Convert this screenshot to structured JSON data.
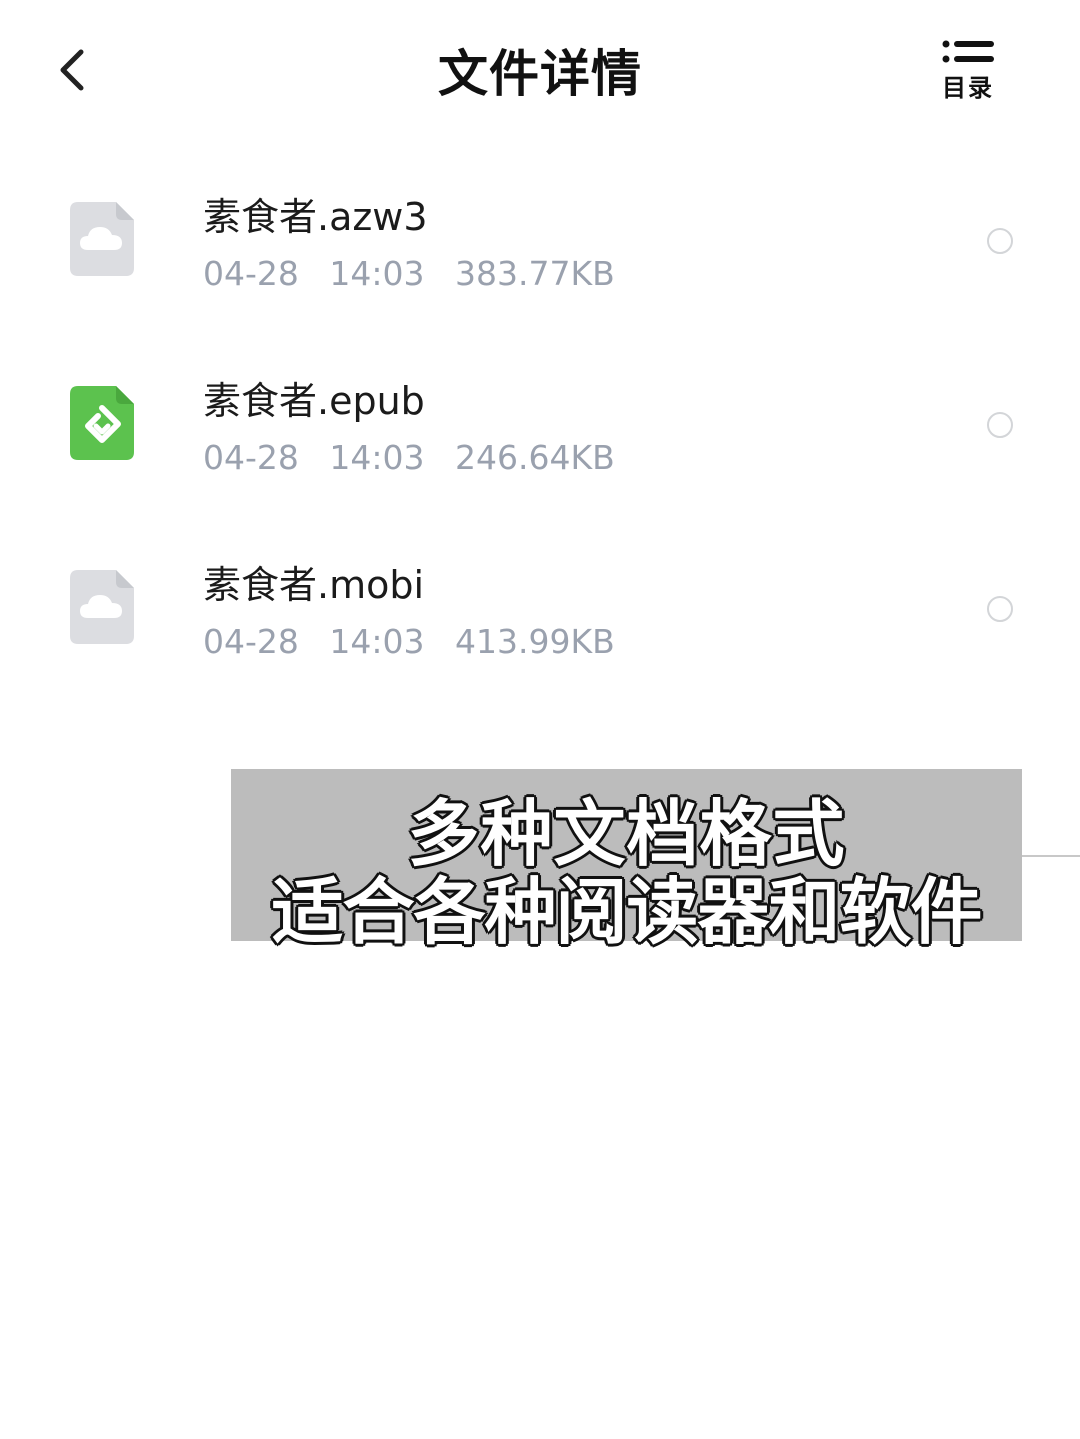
{
  "header": {
    "title": "文件详情",
    "toc_label": "目录"
  },
  "files": [
    {
      "name": "素食者.azw3",
      "date": "04-28",
      "time": "14:03",
      "size": "383.77KB",
      "icon": "cloud-file-icon"
    },
    {
      "name": "素食者.epub",
      "date": "04-28",
      "time": "14:03",
      "size": "246.64KB",
      "icon": "epub-file-icon"
    },
    {
      "name": "素食者.mobi",
      "date": "04-28",
      "time": "14:03",
      "size": "413.99KB",
      "icon": "cloud-file-icon"
    }
  ],
  "caption": {
    "line1": "多种文档格式",
    "line2": "适合各种阅读器和软件"
  },
  "colors": {
    "meta_text": "#9aa1ae",
    "epub_green": "#5cc24e",
    "cloud_file_gray": "#dcdde1",
    "caption_bg": "#bcbcbc"
  }
}
